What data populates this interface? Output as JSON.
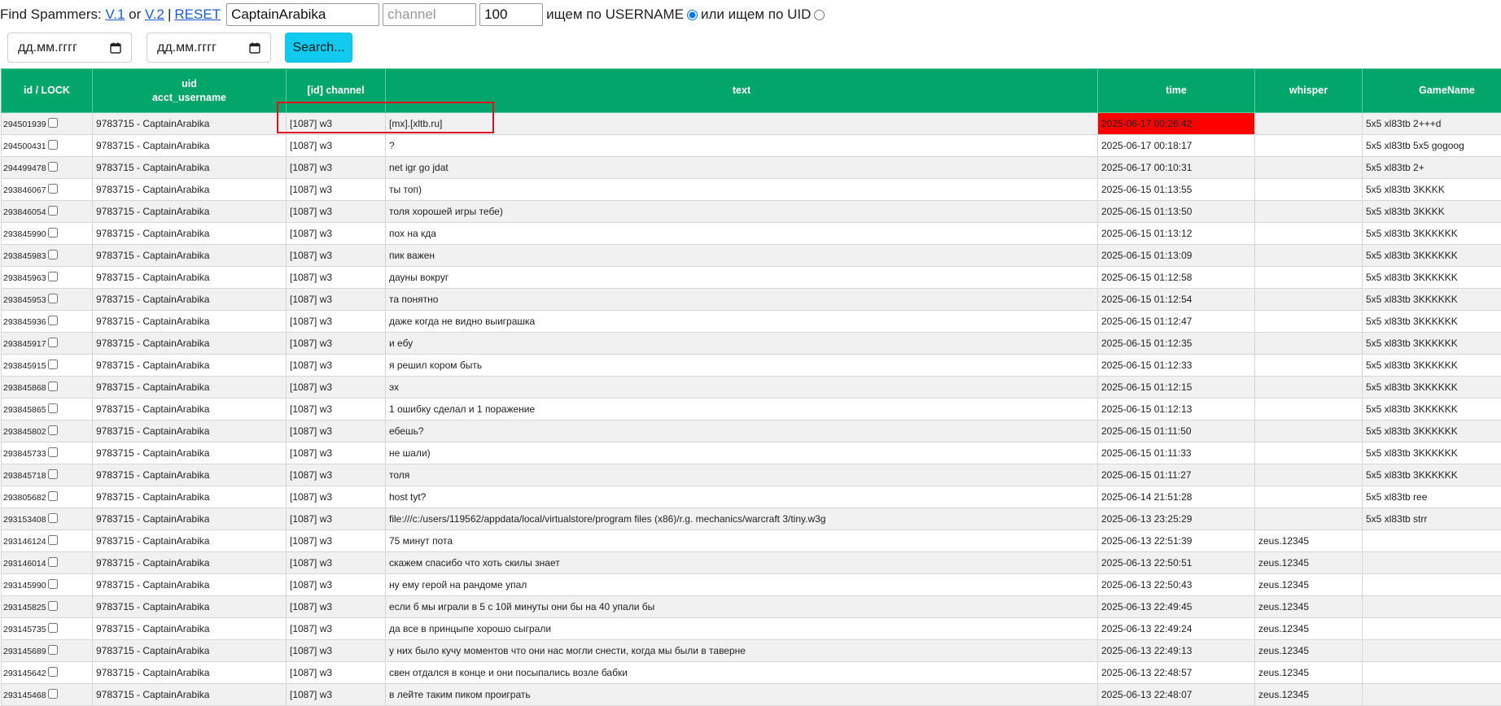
{
  "toolbar": {
    "label": "Find Spammers:",
    "v1_link": "V.1",
    "or_text": "or",
    "v2_link": "V.2",
    "separator": "|",
    "reset_link": "RESET",
    "username_value": "CaptainArabika",
    "channel_placeholder": "channel",
    "limit_value": "100",
    "search_by_username_label": "ищем по USERNAME",
    "search_by_uid_label": "или ищем по UID",
    "search_by_username_checked": true
  },
  "dates": {
    "from_placeholder": "дд.мм.гггг",
    "to_placeholder": "дд.мм.гггг"
  },
  "search_button": "Search...",
  "colors": {
    "header_bg": "#03a66a",
    "highlight_time": "#ff0000",
    "button_bg": "#10cbef",
    "annotation": "#e4101f"
  },
  "table": {
    "headers": {
      "id": "id / LOCK",
      "uid_line1": "uid",
      "uid_line2": "acct_username",
      "channel": "[id] channel",
      "text": "text",
      "time": "time",
      "whisper": "whisper",
      "game": "GameName"
    },
    "rows": [
      {
        "id": "294501939",
        "uid": "9783715 - CaptainArabika",
        "channel": "[1087] w3",
        "text": "[mx].[xltb.ru]",
        "time": "2025-06-17 00:26:42",
        "whisper": "",
        "game": "5x5 xl83tb 2+++d",
        "time_highlight": true
      },
      {
        "id": "294500431",
        "uid": "9783715 - CaptainArabika",
        "channel": "[1087] w3",
        "text": "?",
        "time": "2025-06-17 00:18:17",
        "whisper": "",
        "game": "5x5 xl83tb 5x5 gogoog"
      },
      {
        "id": "294499478",
        "uid": "9783715 - CaptainArabika",
        "channel": "[1087] w3",
        "text": "net igr go jdat",
        "time": "2025-06-17 00:10:31",
        "whisper": "",
        "game": "5x5 xl83tb 2+"
      },
      {
        "id": "293846067",
        "uid": "9783715 - CaptainArabika",
        "channel": "[1087] w3",
        "text": "ты топ)",
        "time": "2025-06-15 01:13:55",
        "whisper": "",
        "game": "5x5 xl83tb 3KKKK"
      },
      {
        "id": "293846054",
        "uid": "9783715 - CaptainArabika",
        "channel": "[1087] w3",
        "text": "толя хорошей игры тебе)",
        "time": "2025-06-15 01:13:50",
        "whisper": "",
        "game": "5x5 xl83tb 3KKKK"
      },
      {
        "id": "293845990",
        "uid": "9783715 - CaptainArabika",
        "channel": "[1087] w3",
        "text": "пох на кда",
        "time": "2025-06-15 01:13:12",
        "whisper": "",
        "game": "5x5 xl83tb 3KKKKKK"
      },
      {
        "id": "293845983",
        "uid": "9783715 - CaptainArabika",
        "channel": "[1087] w3",
        "text": "пик важен",
        "time": "2025-06-15 01:13:09",
        "whisper": "",
        "game": "5x5 xl83tb 3KKKKKK"
      },
      {
        "id": "293845963",
        "uid": "9783715 - CaptainArabika",
        "channel": "[1087] w3",
        "text": "дауны вокруг",
        "time": "2025-06-15 01:12:58",
        "whisper": "",
        "game": "5x5 xl83tb 3KKKKKK"
      },
      {
        "id": "293845953",
        "uid": "9783715 - CaptainArabika",
        "channel": "[1087] w3",
        "text": "та понятно",
        "time": "2025-06-15 01:12:54",
        "whisper": "",
        "game": "5x5 xl83tb 3KKKKKK"
      },
      {
        "id": "293845936",
        "uid": "9783715 - CaptainArabika",
        "channel": "[1087] w3",
        "text": "даже когда не видно выиграшка",
        "time": "2025-06-15 01:12:47",
        "whisper": "",
        "game": "5x5 xl83tb 3KKKKKK"
      },
      {
        "id": "293845917",
        "uid": "9783715 - CaptainArabika",
        "channel": "[1087] w3",
        "text": "и ебу",
        "time": "2025-06-15 01:12:35",
        "whisper": "",
        "game": "5x5 xl83tb 3KKKKKK"
      },
      {
        "id": "293845915",
        "uid": "9783715 - CaptainArabika",
        "channel": "[1087] w3",
        "text": "я решил кором быть",
        "time": "2025-06-15 01:12:33",
        "whisper": "",
        "game": "5x5 xl83tb 3KKKKKK"
      },
      {
        "id": "293845868",
        "uid": "9783715 - CaptainArabika",
        "channel": "[1087] w3",
        "text": "эх",
        "time": "2025-06-15 01:12:15",
        "whisper": "",
        "game": "5x5 xl83tb 3KKKKKK"
      },
      {
        "id": "293845865",
        "uid": "9783715 - CaptainArabika",
        "channel": "[1087] w3",
        "text": "1 ошибку сделал и 1 поражение",
        "time": "2025-06-15 01:12:13",
        "whisper": "",
        "game": "5x5 xl83tb 3KKKKKK"
      },
      {
        "id": "293845802",
        "uid": "9783715 - CaptainArabika",
        "channel": "[1087] w3",
        "text": "ебешь?",
        "time": "2025-06-15 01:11:50",
        "whisper": "",
        "game": "5x5 xl83tb 3KKKKKK"
      },
      {
        "id": "293845733",
        "uid": "9783715 - CaptainArabika",
        "channel": "[1087] w3",
        "text": "не шали)",
        "time": "2025-06-15 01:11:33",
        "whisper": "",
        "game": "5x5 xl83tb 3KKKKKK"
      },
      {
        "id": "293845718",
        "uid": "9783715 - CaptainArabika",
        "channel": "[1087] w3",
        "text": "толя",
        "time": "2025-06-15 01:11:27",
        "whisper": "",
        "game": "5x5 xl83tb 3KKKKKK"
      },
      {
        "id": "293805682",
        "uid": "9783715 - CaptainArabika",
        "channel": "[1087] w3",
        "text": "host tyt?",
        "time": "2025-06-14 21:51:28",
        "whisper": "",
        "game": "5x5 xl83tb ree"
      },
      {
        "id": "293153408",
        "uid": "9783715 - CaptainArabika",
        "channel": "[1087] w3",
        "text": "file:///c:/users/119562/appdata/local/virtualstore/program files (x86)/r.g. mechanics/warcraft 3/tiny.w3g",
        "time": "2025-06-13 23:25:29",
        "whisper": "",
        "game": "5x5 xl83tb strr"
      },
      {
        "id": "293146124",
        "uid": "9783715 - CaptainArabika",
        "channel": "[1087] w3",
        "text": "75 минут пота",
        "time": "2025-06-13 22:51:39",
        "whisper": "zeus.12345",
        "game": ""
      },
      {
        "id": "293146014",
        "uid": "9783715 - CaptainArabika",
        "channel": "[1087] w3",
        "text": "скажем спасибо что хоть скилы знает",
        "time": "2025-06-13 22:50:51",
        "whisper": "zeus.12345",
        "game": ""
      },
      {
        "id": "293145990",
        "uid": "9783715 - CaptainArabika",
        "channel": "[1087] w3",
        "text": "ну ему герой на рандоме упал",
        "time": "2025-06-13 22:50:43",
        "whisper": "zeus.12345",
        "game": ""
      },
      {
        "id": "293145825",
        "uid": "9783715 - CaptainArabika",
        "channel": "[1087] w3",
        "text": "если б мы играли в 5 с 10й минуты они бы на 40 упали бы",
        "time": "2025-06-13 22:49:45",
        "whisper": "zeus.12345",
        "game": ""
      },
      {
        "id": "293145735",
        "uid": "9783715 - CaptainArabika",
        "channel": "[1087] w3",
        "text": "да все в принцыпе хорошо сыграли",
        "time": "2025-06-13 22:49:24",
        "whisper": "zeus.12345",
        "game": ""
      },
      {
        "id": "293145689",
        "uid": "9783715 - CaptainArabika",
        "channel": "[1087] w3",
        "text": "у них было кучу моментов что они нас могли снести, когда мы были в таверне",
        "time": "2025-06-13 22:49:13",
        "whisper": "zeus.12345",
        "game": ""
      },
      {
        "id": "293145642",
        "uid": "9783715 - CaptainArabika",
        "channel": "[1087] w3",
        "text": "свен отдался в конце и они посыпались возле бабки",
        "time": "2025-06-13 22:48:57",
        "whisper": "zeus.12345",
        "game": ""
      },
      {
        "id": "293145468",
        "uid": "9783715 - CaptainArabika",
        "channel": "[1087] w3",
        "text": "в лейте таким пиком проиграть",
        "time": "2025-06-13 22:48:07",
        "whisper": "zeus.12345",
        "game": ""
      }
    ]
  }
}
